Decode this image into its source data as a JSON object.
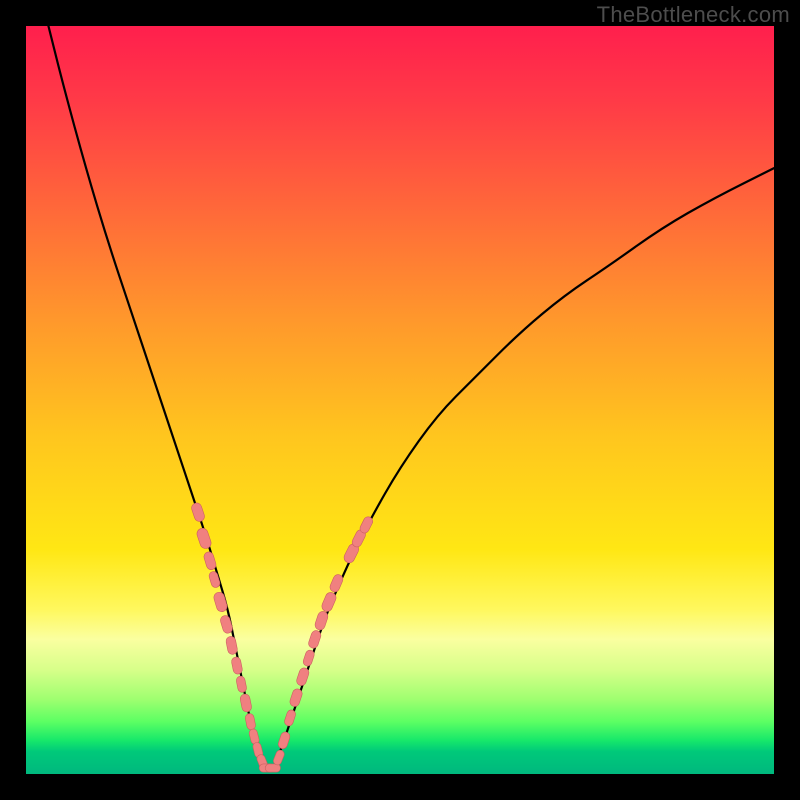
{
  "watermark": "TheBottleneck.com",
  "colors": {
    "gradient_stops": [
      {
        "offset": 0.0,
        "color": "#ff1f4d"
      },
      {
        "offset": 0.1,
        "color": "#ff3a47"
      },
      {
        "offset": 0.25,
        "color": "#ff6a39"
      },
      {
        "offset": 0.4,
        "color": "#ff9a2b"
      },
      {
        "offset": 0.55,
        "color": "#ffc61e"
      },
      {
        "offset": 0.7,
        "color": "#ffe714"
      },
      {
        "offset": 0.78,
        "color": "#fff85e"
      },
      {
        "offset": 0.82,
        "color": "#faffa0"
      },
      {
        "offset": 0.86,
        "color": "#d8ff8a"
      },
      {
        "offset": 0.9,
        "color": "#9fff70"
      },
      {
        "offset": 0.93,
        "color": "#5cff63"
      },
      {
        "offset": 0.955,
        "color": "#17e86a"
      },
      {
        "offset": 0.97,
        "color": "#00c97a"
      },
      {
        "offset": 1.0,
        "color": "#00b87e"
      }
    ],
    "curve": "#000000",
    "marker_fill": "#f08080",
    "marker_stroke": "#cc6060"
  },
  "chart_data": {
    "type": "line",
    "title": "",
    "xlabel": "",
    "ylabel": "",
    "xlim": [
      0,
      100
    ],
    "ylim": [
      0,
      100
    ],
    "series": [
      {
        "name": "bottleneck-curve",
        "x": [
          3,
          5,
          8,
          11,
          14,
          17,
          20,
          22,
          24,
          25.5,
          27,
          28,
          29,
          30,
          31,
          32,
          33,
          34,
          36,
          38,
          40,
          43,
          46,
          50,
          55,
          60,
          66,
          72,
          78,
          85,
          92,
          100
        ],
        "y": [
          100,
          92,
          81,
          71,
          62,
          53,
          44,
          38,
          32,
          27,
          22,
          17,
          12,
          7,
          3,
          0.5,
          0.5,
          3,
          9,
          15,
          21,
          28,
          34,
          41,
          48,
          53,
          59,
          64,
          68,
          73,
          77,
          81
        ]
      }
    ],
    "markers": [
      {
        "x": 23.0,
        "y": 35.0,
        "r": 2.1
      },
      {
        "x": 23.8,
        "y": 31.5,
        "r": 2.3
      },
      {
        "x": 24.6,
        "y": 28.5,
        "r": 2.0
      },
      {
        "x": 25.2,
        "y": 26.0,
        "r": 1.8
      },
      {
        "x": 26.0,
        "y": 23.0,
        "r": 2.2
      },
      {
        "x": 26.8,
        "y": 20.0,
        "r": 2.0
      },
      {
        "x": 27.5,
        "y": 17.2,
        "r": 2.0
      },
      {
        "x": 28.2,
        "y": 14.5,
        "r": 1.9
      },
      {
        "x": 28.8,
        "y": 12.0,
        "r": 1.8
      },
      {
        "x": 29.4,
        "y": 9.5,
        "r": 2.0
      },
      {
        "x": 30.0,
        "y": 7.0,
        "r": 1.8
      },
      {
        "x": 30.5,
        "y": 5.0,
        "r": 1.7
      },
      {
        "x": 31.0,
        "y": 3.2,
        "r": 1.7
      },
      {
        "x": 31.6,
        "y": 1.6,
        "r": 1.7
      },
      {
        "x": 32.2,
        "y": 0.8,
        "r": 1.7
      },
      {
        "x": 33.0,
        "y": 0.8,
        "r": 1.7
      },
      {
        "x": 33.8,
        "y": 2.2,
        "r": 1.7
      },
      {
        "x": 34.5,
        "y": 4.5,
        "r": 1.9
      },
      {
        "x": 35.3,
        "y": 7.5,
        "r": 1.8
      },
      {
        "x": 36.1,
        "y": 10.2,
        "r": 2.0
      },
      {
        "x": 37.0,
        "y": 13.0,
        "r": 2.0
      },
      {
        "x": 37.8,
        "y": 15.5,
        "r": 1.8
      },
      {
        "x": 38.6,
        "y": 18.0,
        "r": 2.0
      },
      {
        "x": 39.5,
        "y": 20.5,
        "r": 2.1
      },
      {
        "x": 40.5,
        "y": 23.0,
        "r": 2.2
      },
      {
        "x": 41.5,
        "y": 25.5,
        "r": 2.0
      },
      {
        "x": 43.5,
        "y": 29.5,
        "r": 2.2
      },
      {
        "x": 44.5,
        "y": 31.5,
        "r": 2.0
      },
      {
        "x": 45.5,
        "y": 33.3,
        "r": 1.9
      }
    ]
  }
}
